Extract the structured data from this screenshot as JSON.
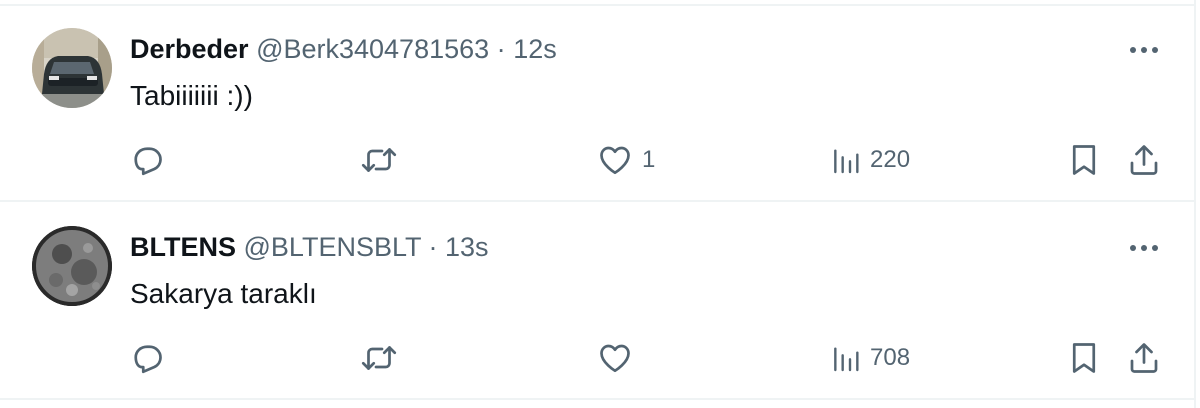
{
  "tweets": [
    {
      "display_name": "Derbeder",
      "handle": "@Berk3404781563",
      "separator": "·",
      "time": "12s",
      "text": "Tabiiiiiii :))",
      "replies": "",
      "retweets": "",
      "likes": "1",
      "views": "220"
    },
    {
      "display_name": "BLTENS",
      "handle": "@BLTENSBLT",
      "separator": "·",
      "time": "13s",
      "text": "Sakarya taraklı",
      "replies": "",
      "retweets": "",
      "likes": "",
      "views": "708"
    }
  ],
  "icons": {
    "reply": "reply-icon",
    "retweet": "retweet-icon",
    "like": "heart-icon",
    "views": "views-icon",
    "bookmark": "bookmark-icon",
    "share": "share-icon",
    "more": "more-icon"
  },
  "colors": {
    "text": "#0f1419",
    "secondary": "#536471",
    "divider": "#eff3f4"
  }
}
